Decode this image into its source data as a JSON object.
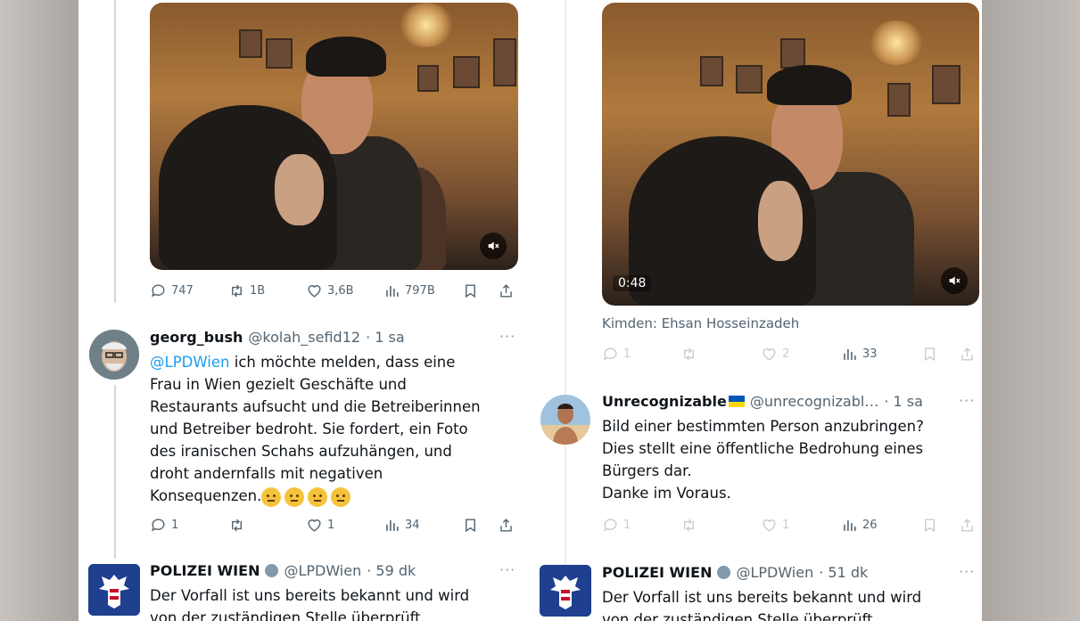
{
  "left_column": {
    "video_stats": {
      "replies": "747",
      "reposts": "1B",
      "likes": "3,6B",
      "views": "797B"
    },
    "reply_tweet": {
      "name": "georg_bush",
      "handle": "@kolah_sefid12",
      "time": "· 1 sa",
      "mention": "@LPDWien",
      "text_lines": [
        " ich möchte melden, dass eine",
        "Frau in Wien gezielt Geschäfte und",
        "Restaurants aufsucht und die Betreiberinnen",
        "und Betreiber bedroht. Sie fordert, ein Foto",
        "des iranischen Schahs aufzuhängen, und",
        "droht andernfalls mit negativen",
        "Konsequenzen."
      ],
      "replies": "1",
      "likes": "1",
      "views": "34"
    },
    "police_tweet": {
      "name": "POLIZEI WIEN",
      "handle": "@LPDWien",
      "time": "· 59 dk",
      "text_lines": [
        "Der Vorfall ist uns bereits bekannt und wird",
        "von der zuständigen Stelle überprüft."
      ]
    }
  },
  "right_column": {
    "video_duration": "0:48",
    "caption": "Kimden: Ehsan Hosseinzadeh",
    "video_stats": {
      "replies": "1",
      "likes": "2",
      "views": "33"
    },
    "reply_tweet": {
      "name": "Unrecognizable",
      "handle": "@unrecognizabl…",
      "time": "· 1 sa",
      "text_lines": [
        "Bild einer bestimmten Person anzubringen?",
        "Dies stellt eine öffentliche Bedrohung eines",
        "Bürgers dar.",
        "Danke im Voraus."
      ],
      "replies": "1",
      "likes": "1",
      "views": "26"
    },
    "police_tweet": {
      "name": "POLIZEI WIEN",
      "handle": "@LPDWien",
      "time": "· 51 dk",
      "text_lines": [
        "Der Vorfall ist uns bereits bekannt und wird",
        "von der zuständigen Stelle überprüft."
      ]
    }
  },
  "icons": {
    "reply": "reply-icon",
    "repost": "repost-icon",
    "like": "heart-icon",
    "views": "views-icon",
    "bookmark": "bookmark-icon",
    "share": "share-icon",
    "mute": "speaker-muted-icon",
    "verified": "verified-badge-icon",
    "flag": "ukraine-flag-icon"
  },
  "colors": {
    "link": "#1d9bf0",
    "secondary_text": "#536471",
    "police_blue": "#1f3f8f"
  }
}
